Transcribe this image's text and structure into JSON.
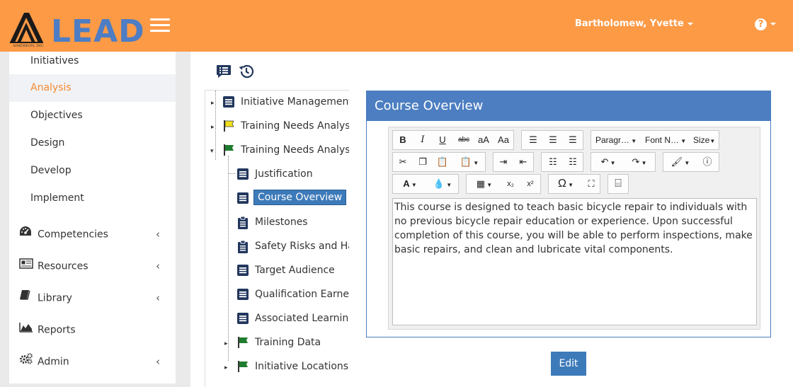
{
  "brand": {
    "name": "LEAD",
    "company": "AIMEREON, INC."
  },
  "header": {
    "user_name": "Bartholomew, Yvette",
    "help_symbol": "?"
  },
  "sidebar": {
    "sub_items": [
      {
        "label": "Initiatives"
      },
      {
        "label": "Analysis",
        "active": true
      },
      {
        "label": "Objectives"
      },
      {
        "label": "Design"
      },
      {
        "label": "Develop"
      },
      {
        "label": "Implement"
      }
    ],
    "main_items": [
      {
        "label": "Competencies",
        "icon": "dashboard-icon",
        "has_chevron": true
      },
      {
        "label": "Resources",
        "icon": "resources-icon",
        "has_chevron": true
      },
      {
        "label": "Library",
        "icon": "book-icon",
        "has_chevron": true
      },
      {
        "label": "Reports",
        "icon": "area-chart-icon",
        "has_chevron": false
      },
      {
        "label": "Admin",
        "icon": "gears-icon",
        "has_chevron": true
      }
    ]
  },
  "tree": {
    "nodes": [
      {
        "label": "Initiative Management",
        "icon": "document-icon"
      },
      {
        "label": "Training Needs Analysis",
        "icon": "yellow-flag-icon"
      },
      {
        "label": "Training Needs Analysis",
        "icon": "green-flag-icon",
        "expanded": true
      },
      {
        "label": "Justification",
        "icon": "document-icon"
      },
      {
        "label": "Course Overview",
        "icon": "document-icon",
        "selected": true
      },
      {
        "label": "Milestones",
        "icon": "clipboard-icon"
      },
      {
        "label": "Safety Risks and Hazards",
        "icon": "clipboard-icon"
      },
      {
        "label": "Target Audience",
        "icon": "document-icon"
      },
      {
        "label": "Qualification Earned",
        "icon": "document-icon"
      },
      {
        "label": "Associated Learning Events",
        "icon": "document-icon"
      },
      {
        "label": "Training Data",
        "icon": "green-flag-icon"
      },
      {
        "label": "Initiative Locations",
        "icon": "green-flag-icon"
      }
    ]
  },
  "panel": {
    "title": "Course Overview",
    "body": "This course is designed to teach basic bicycle repair to individuals with no previous bicycle repair education or experience. Upon successful completion of this course, you will be able to perform inspections, make basic repairs, and clean and lubricate vital components.",
    "toolbar": {
      "bold": "B",
      "italic": "I",
      "underline": "U",
      "strike": "abc",
      "upper": "aA",
      "caps": "Aa",
      "paragraph": "Paragr…",
      "font_name": "Font N…",
      "size": "Size",
      "font_color": "A",
      "omega": "Ω",
      "subscript": "x₂",
      "superscript": "x²"
    },
    "edit_label": "Edit"
  },
  "colors": {
    "header": "#fd9a46",
    "accent": "#f58a2f",
    "panel_header": "#4c7ec1",
    "button": "#3d7ab9",
    "logo_blue": "#4d7dc4"
  }
}
